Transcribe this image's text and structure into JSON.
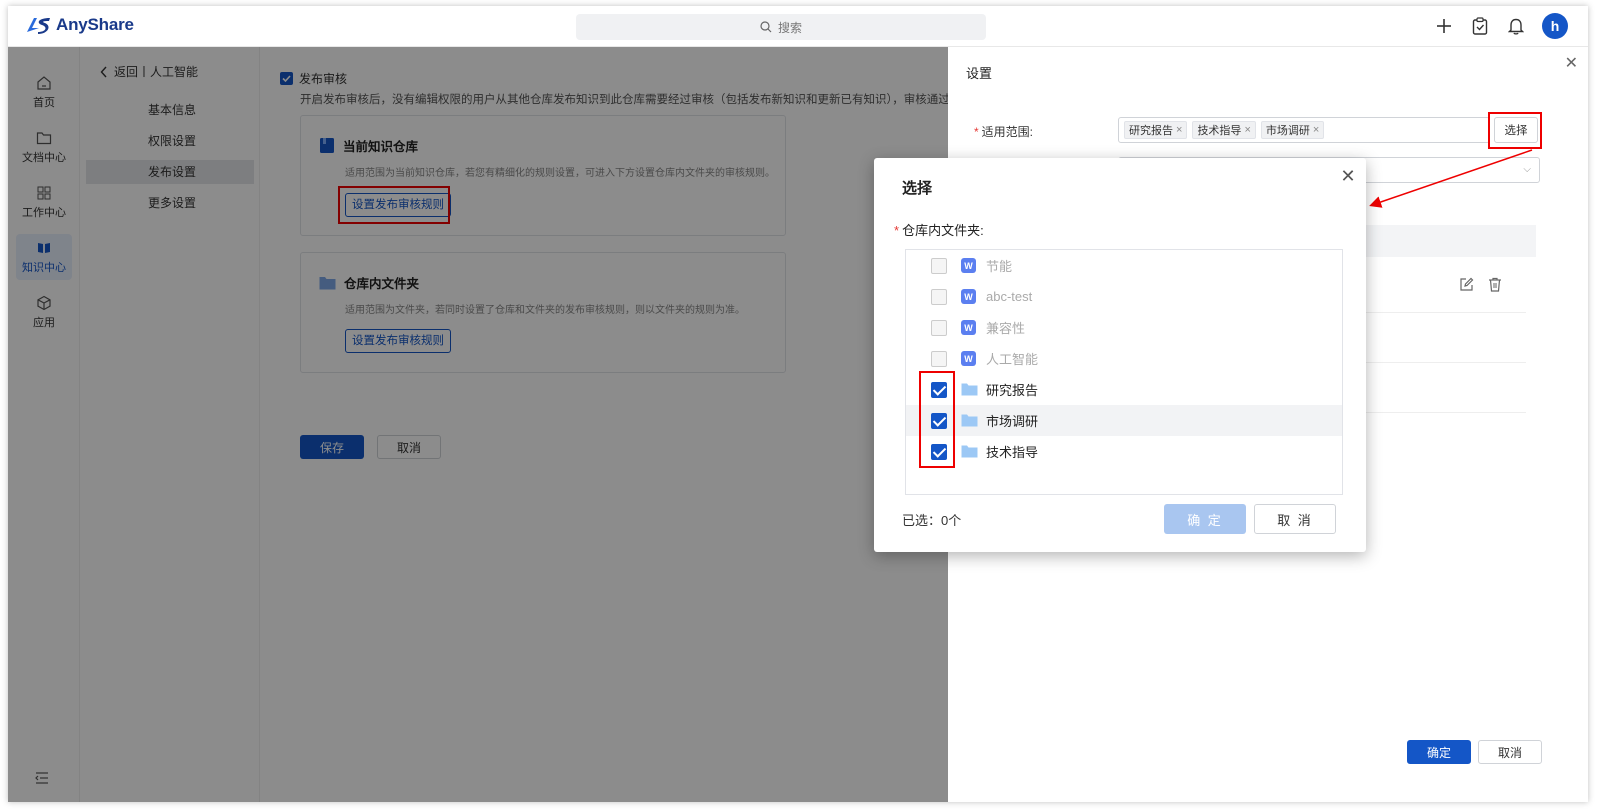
{
  "app": {
    "name": "AnyShare"
  },
  "topbar": {
    "search_placeholder": "搜索",
    "avatar_letter": "h"
  },
  "rail": {
    "items": [
      {
        "label": "首页",
        "icon": "home-icon"
      },
      {
        "label": "文档中心",
        "icon": "folder-icon"
      },
      {
        "label": "工作中心",
        "icon": "grid-icon"
      },
      {
        "label": "知识中心",
        "icon": "book-icon",
        "active": true
      },
      {
        "label": "应用",
        "icon": "cube-icon"
      }
    ]
  },
  "subnav": {
    "back_label": "返回丨人工智能",
    "items": [
      {
        "label": "基本信息"
      },
      {
        "label": "权限设置"
      },
      {
        "label": "发布设置",
        "active": true
      },
      {
        "label": "更多设置"
      }
    ]
  },
  "content": {
    "review_checkbox_label": "发布审核",
    "review_desc": "开启发布审核后，没有编辑权限的用户从其他仓库发布知识到此仓库需要经过审核（包括发布新知识和更新已有知识），审核通过",
    "card1": {
      "title": "当前知识仓库",
      "desc": "适用范围为当前知识仓库，若您有精细化的规则设置，可进入下方设置仓库内文件夹的审核规则。",
      "button": "设置发布审核规则"
    },
    "card2": {
      "title": "仓库内文件夹",
      "desc": "适用范围为文件夹，若同时设置了仓库和文件夹的发布审核规则，则以文件夹的规则为准。",
      "button": "设置发布审核规则"
    },
    "save_label": "保存",
    "cancel_label": "取消"
  },
  "drawer": {
    "title": "设置",
    "scope_label": "适用范围:",
    "tags": [
      "研究报告",
      "技术指导",
      "市场调研"
    ],
    "select_button": "选择",
    "ok_label": "确定",
    "cancel_label": "取消"
  },
  "modal": {
    "title": "选择",
    "field_label": "仓库内文件夹:",
    "items": [
      {
        "label": "节能",
        "type": "kb",
        "checked": false,
        "disabled": true
      },
      {
        "label": "abc-test",
        "type": "kb",
        "checked": false,
        "disabled": true
      },
      {
        "label": "兼容性",
        "type": "kb",
        "checked": false,
        "disabled": true
      },
      {
        "label": "人工智能",
        "type": "kb",
        "checked": false,
        "disabled": true
      },
      {
        "label": "研究报告",
        "type": "folder",
        "checked": true,
        "disabled": false
      },
      {
        "label": "市场调研",
        "type": "folder",
        "checked": true,
        "disabled": false
      },
      {
        "label": "技术指导",
        "type": "folder",
        "checked": true,
        "disabled": false
      }
    ],
    "selected_count": "已选：0个",
    "ok_label": "确 定",
    "cancel_label": "取 消"
  },
  "colors": {
    "primary": "#1456c7",
    "highlight": "#e00000",
    "disabled_primary": "#a9c6f0"
  }
}
